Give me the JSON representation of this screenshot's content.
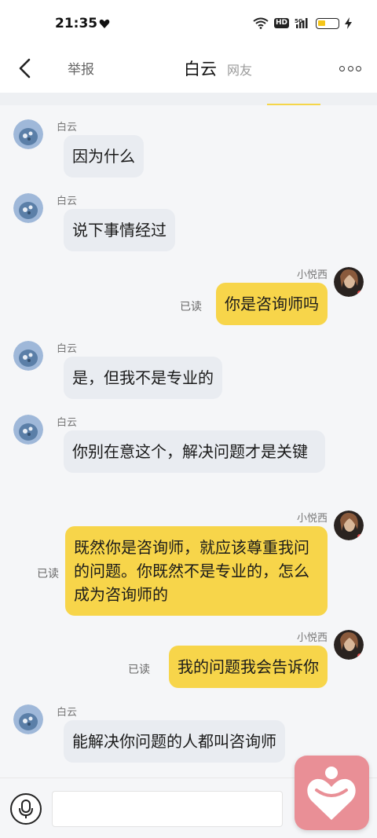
{
  "status_bar": {
    "time": "21:35",
    "hd_label": "HD",
    "network_label": "5G"
  },
  "nav": {
    "report_label": "举报",
    "title": "白云",
    "subtitle": "网友"
  },
  "messages": [
    {
      "side": "left",
      "sender": "白云",
      "text": "因为什么"
    },
    {
      "side": "left",
      "sender": "白云",
      "text": "说下事情经过"
    },
    {
      "side": "right",
      "sender": "小悦西",
      "text": "你是咨询师吗",
      "status": "已读"
    },
    {
      "side": "left",
      "sender": "白云",
      "text": "是，但我不是专业的"
    },
    {
      "side": "left",
      "sender": "白云",
      "text": "你别在意这个，解决问题才是关键"
    },
    {
      "side": "right",
      "sender": "小悦西",
      "text": "既然你是咨询师，就应该尊重我问的问题。你既然不是专业的，怎么成为咨询师的",
      "status": "已读"
    },
    {
      "side": "right",
      "sender": "小悦西",
      "text": "我的问题我会告诉你",
      "status": "已读"
    },
    {
      "side": "left",
      "sender": "白云",
      "text": "能解决你问题的人都叫咨询师"
    }
  ],
  "input": {
    "value": "",
    "placeholder": ""
  },
  "colors": {
    "own_bubble": "#f7d54a",
    "other_bubble": "#e9ecf1",
    "float_button": "#e98f96"
  },
  "icons": [
    "back-arrow-icon",
    "more-icon",
    "microphone-icon",
    "heart-person-icon"
  ]
}
